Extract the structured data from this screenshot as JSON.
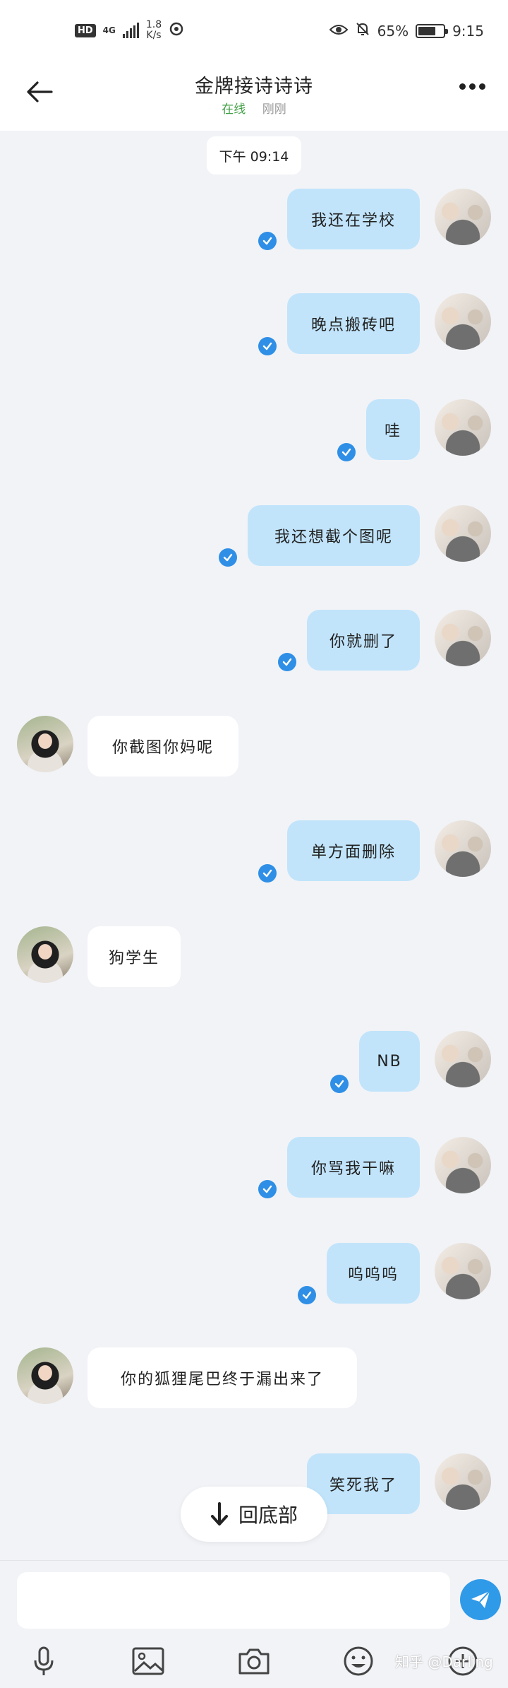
{
  "status_bar": {
    "hd": "HD",
    "network": "4G",
    "speed_value": "1.8",
    "speed_unit": "K/s",
    "battery_percent": "65%",
    "time": "9:15"
  },
  "header": {
    "title": "金牌接诗诗诗",
    "online": "在线",
    "last_seen": "刚刚"
  },
  "chat": {
    "timestamp": "下午 09:14",
    "messages": [
      {
        "from": "me",
        "text": "我还在学校"
      },
      {
        "from": "me",
        "text": "晚点搬砖吧"
      },
      {
        "from": "me",
        "text": "哇"
      },
      {
        "from": "me",
        "text": "我还想截个图呢"
      },
      {
        "from": "me",
        "text": "你就删了"
      },
      {
        "from": "other",
        "text": "你截图你妈呢"
      },
      {
        "from": "me",
        "text": "单方面删除"
      },
      {
        "from": "other",
        "text": "狗学生"
      },
      {
        "from": "me",
        "text": "NB"
      },
      {
        "from": "me",
        "text": "你骂我干嘛"
      },
      {
        "from": "me",
        "text": "呜呜呜"
      },
      {
        "from": "other",
        "text": "你的狐狸尾巴终于漏出来了"
      },
      {
        "from": "me",
        "text": "笑死我了"
      }
    ]
  },
  "jump_to_bottom": "回底部",
  "composer": {
    "placeholder": ""
  },
  "watermark": "知乎 @Darling",
  "colors": {
    "my_bubble": "#c1e4fb",
    "accent": "#2f8fe6",
    "online": "#43a047"
  }
}
